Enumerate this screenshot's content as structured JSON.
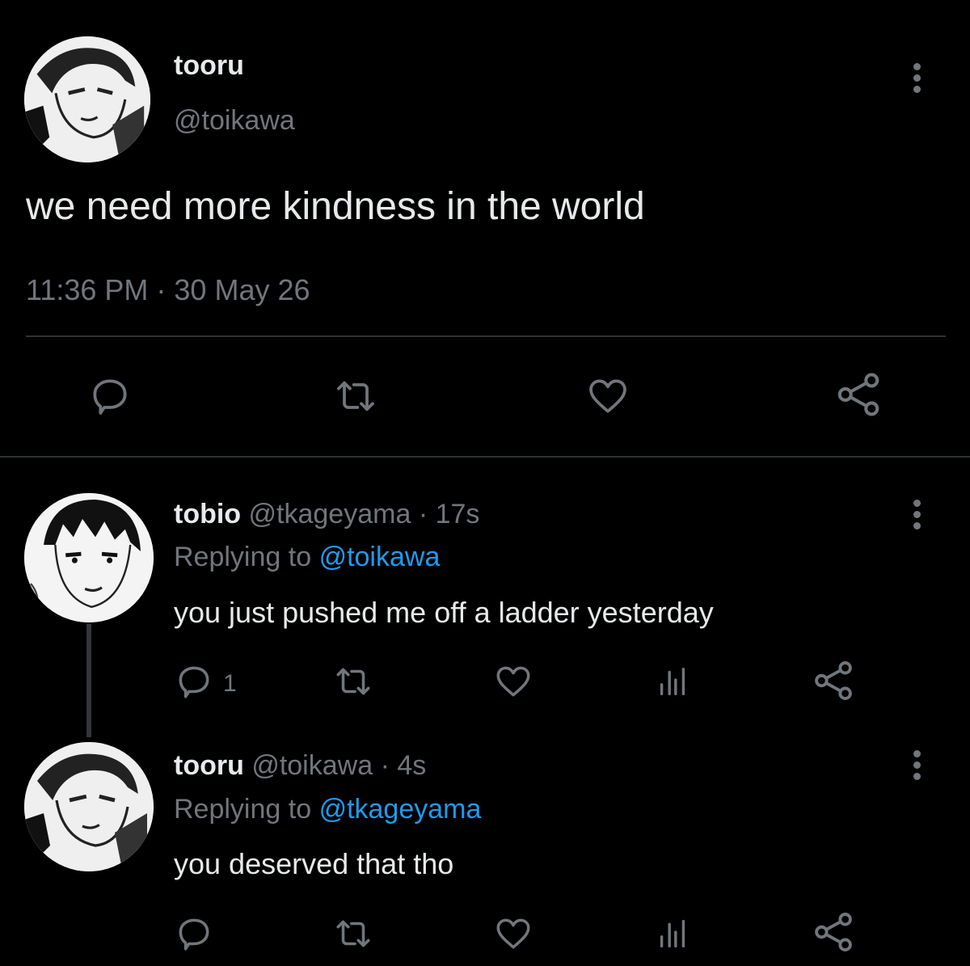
{
  "main_tweet": {
    "display_name": "tooru",
    "handle": "@toikawa",
    "text": "we need more kindness in the world",
    "timestamp": "11:36 PM · 30 May 26"
  },
  "replies": [
    {
      "display_name": "tobio",
      "handle": "@tkageyama",
      "age": "· 17s",
      "replying_label": "Replying to",
      "replying_to": "@toikawa",
      "text": "you just pushed me off a ladder yesterday",
      "reply_count": "1"
    },
    {
      "display_name": "tooru",
      "handle": "@toikawa",
      "age": "· 4s",
      "replying_label": "Replying to",
      "replying_to": "@tkageyama",
      "text": "you deserved that tho",
      "reply_count": ""
    }
  ],
  "icons": {
    "reply": "reply-icon",
    "retweet": "retweet-icon",
    "like": "heart-icon",
    "views": "views-icon",
    "share": "share-icon",
    "more": "more-vertical-icon"
  },
  "colors": {
    "background": "#000000",
    "text": "#e7e9ea",
    "muted": "#71767b",
    "link": "#1d9bf0",
    "divider": "#2f3336"
  }
}
